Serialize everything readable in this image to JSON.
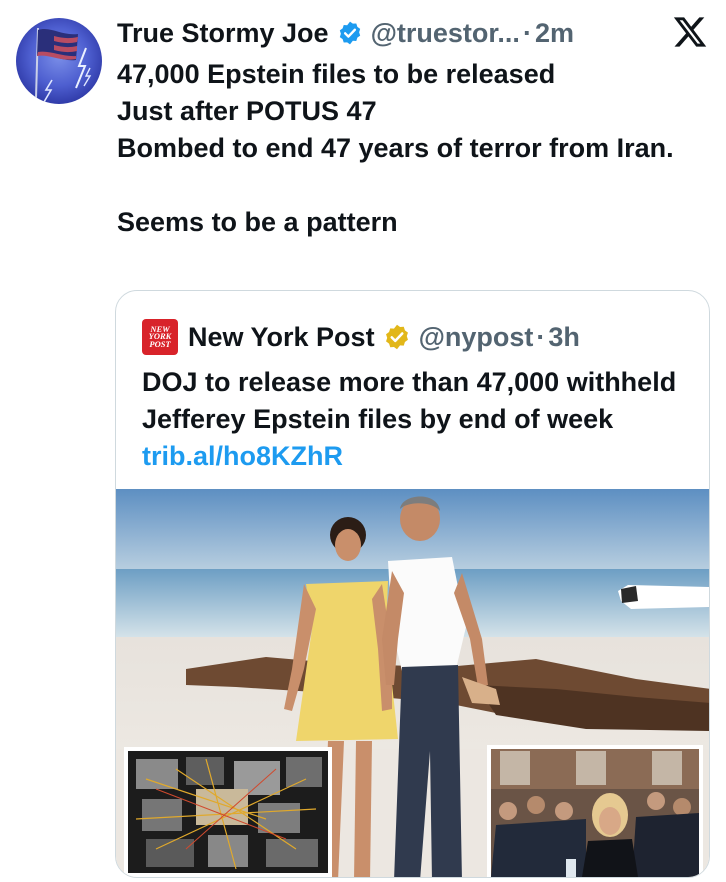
{
  "author": {
    "display_name": "True Stormy Joe",
    "handle": "@truestor...",
    "separator": "·",
    "time": "2m",
    "avatar_icon": "american-flag-lightning-avatar",
    "verified_color": "#1d9bf0"
  },
  "tweet": {
    "text": "47,000 Epstein files to be released\nJust after POTUS 47\nBombed to end 47 years of terror from Iran.\n\nSeems to be a pattern"
  },
  "top_right_icon": "x-logo-icon",
  "quote": {
    "logo_lines": [
      "NEW",
      "YORK",
      "POST"
    ],
    "display_name": "New York Post",
    "handle": "@nypost",
    "separator": "·",
    "time": "3h",
    "verified_color": "#e2b719",
    "text": "DOJ to release more than 47,000 withheld Jefferey Epstein files by end of week ",
    "link": "trib.al/ho8KZhR",
    "link_color": "#1d9bf0",
    "media": {
      "main_photo": "couple-on-beach-photo",
      "inset_left": "evidence-board-photo",
      "inset_right": "press-conference-photo"
    }
  }
}
